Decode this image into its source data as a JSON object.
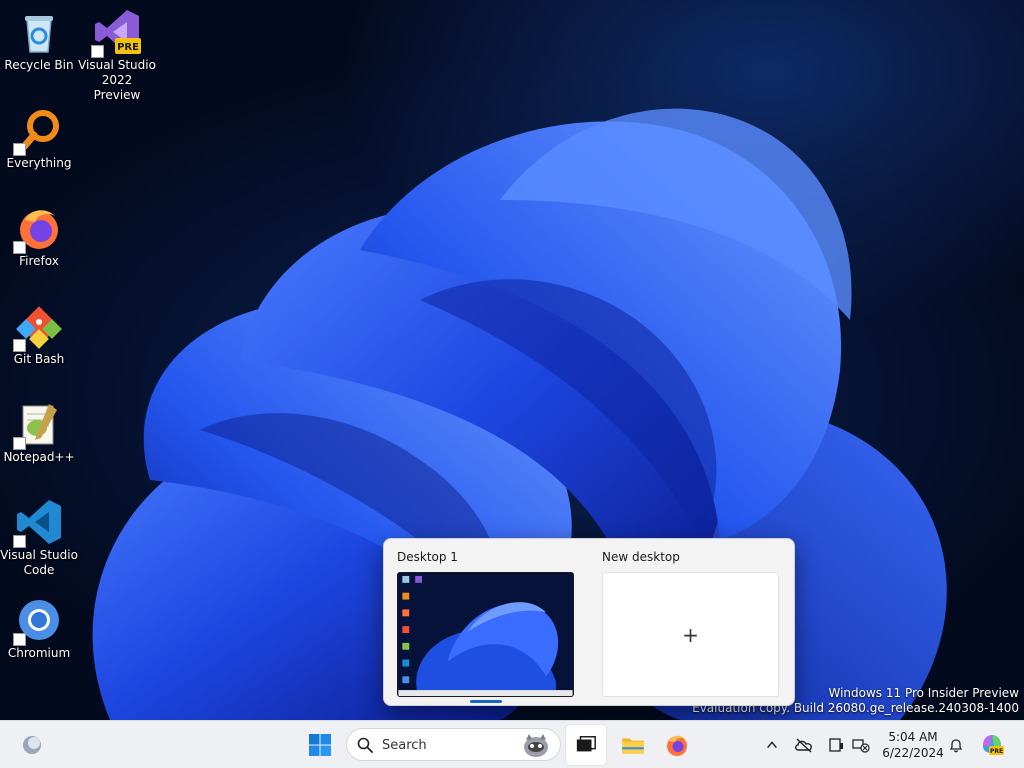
{
  "desktop": {
    "icons": [
      {
        "label": "Recycle Bin",
        "icon": "recycle-bin-icon"
      },
      {
        "label": "Visual Studio 2022 Preview",
        "icon": "visual-studio-preview-icon",
        "badge": "PRE"
      },
      {
        "label": "Everything",
        "icon": "everything-search-icon"
      },
      {
        "label": "Firefox",
        "icon": "firefox-icon"
      },
      {
        "label": "Git Bash",
        "icon": "git-bash-icon"
      },
      {
        "label": "Notepad++",
        "icon": "notepad-plus-plus-icon"
      },
      {
        "label": "Visual Studio Code",
        "icon": "vscode-icon"
      },
      {
        "label": "Chromium",
        "icon": "chromium-icon"
      }
    ],
    "watermark": {
      "line1": "Windows 11 Pro Insider Preview",
      "line2": "Evaluation copy. Build 26080.ge_release.240308-1400"
    }
  },
  "virtual_desktops": {
    "desktops": [
      {
        "name": "Desktop 1",
        "active": true
      },
      {
        "name": "New desktop",
        "plus": "+"
      }
    ]
  },
  "taskbar": {
    "search_text": "Search",
    "clock": {
      "time": "5:04 AM",
      "date": "6/22/2024"
    },
    "pinned": [
      "start-icon",
      "task-view-icon",
      "file-explorer-icon",
      "firefox-icon"
    ],
    "tray": [
      "chevron-up-icon",
      "onedrive-offline-icon",
      "device-icon",
      "network-icon",
      "notification-bell-icon",
      "copilot-icon"
    ],
    "copilot_badge": "PRE"
  },
  "colors": {
    "accent": "#1a66c8",
    "taskbar_bg": "#eef0f4",
    "wallpaper_blue": "#1f4fe0"
  }
}
